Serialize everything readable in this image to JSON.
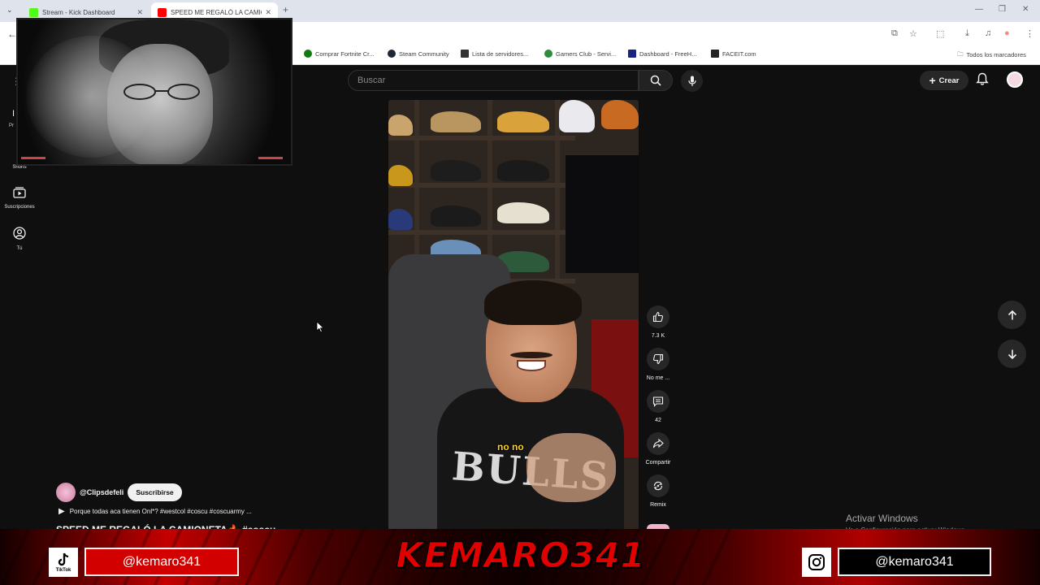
{
  "browser": {
    "tabs": [
      {
        "title": "Stream - Kick Dashboard",
        "favicon_color": "#53fc18",
        "active": false
      },
      {
        "title": "SPEED ME REGALÓ LA CAMIONE",
        "favicon_color": "#ff0000",
        "active": true
      }
    ],
    "new_tab_symbol": "+",
    "window_controls": [
      "—",
      "❐",
      "✕"
    ],
    "bookmarks": [
      {
        "label": "Comprar Fortnite Cr...",
        "icon": "xbox-icon",
        "color": "#107c10"
      },
      {
        "label": "Steam Community",
        "icon": "steam-icon",
        "color": "#1b2838"
      },
      {
        "label": "Lista de servidores...",
        "icon": "list-icon",
        "color": "#333333"
      },
      {
        "label": "Gamers Club - Servi...",
        "icon": "gamersclub-icon",
        "color": "#2d8c3c"
      },
      {
        "label": "Dashboard - FreeH...",
        "icon": "dashboard-icon",
        "color": "#1a237e"
      },
      {
        "label": "FACEIT.com",
        "icon": "faceit-icon",
        "color": "#222222"
      }
    ],
    "all_bookmarks": "Todos los marcadores"
  },
  "youtube": {
    "search_placeholder": "Buscar",
    "create_label": "Crear",
    "left_nav": [
      {
        "label": "Shorts",
        "icon": "shorts-icon"
      },
      {
        "label": "Suscripciones",
        "icon": "subscriptions-icon"
      },
      {
        "label": "Tú",
        "icon": "you-icon"
      }
    ],
    "nav_partial_letter": "I",
    "nav_partial_text": "Pr"
  },
  "short": {
    "caption": "no no",
    "shirt_text": "BULLS",
    "actions": [
      {
        "label": "7.3 K",
        "icon": "like-icon"
      },
      {
        "label": "No me ...",
        "icon": "dislike-icon"
      },
      {
        "label": "42",
        "icon": "comment-icon"
      },
      {
        "label": "Compartir",
        "icon": "share-icon"
      },
      {
        "label": "Remix",
        "icon": "remix-icon"
      }
    ],
    "channel": "@Clipsdefeli",
    "subscribe_label": "Suscribirse",
    "description": "Porque todas aca tienen Onl*? #westcol #coscu #coscuarmy ...",
    "title": "SPEED ME REGALÓ LA CAMIONETA🔥 #coscu ..."
  },
  "windows_watermark": {
    "line1": "Activar Windows",
    "line2": "Ve a Configuración para activar Windows."
  },
  "stream_overlay": {
    "brand": "KEMARO341",
    "tiktok_label": "TikTok",
    "tiktok_handle": "@kemaro341",
    "instagram_handle": "@kemaro341",
    "accent_color": "#d30000"
  }
}
